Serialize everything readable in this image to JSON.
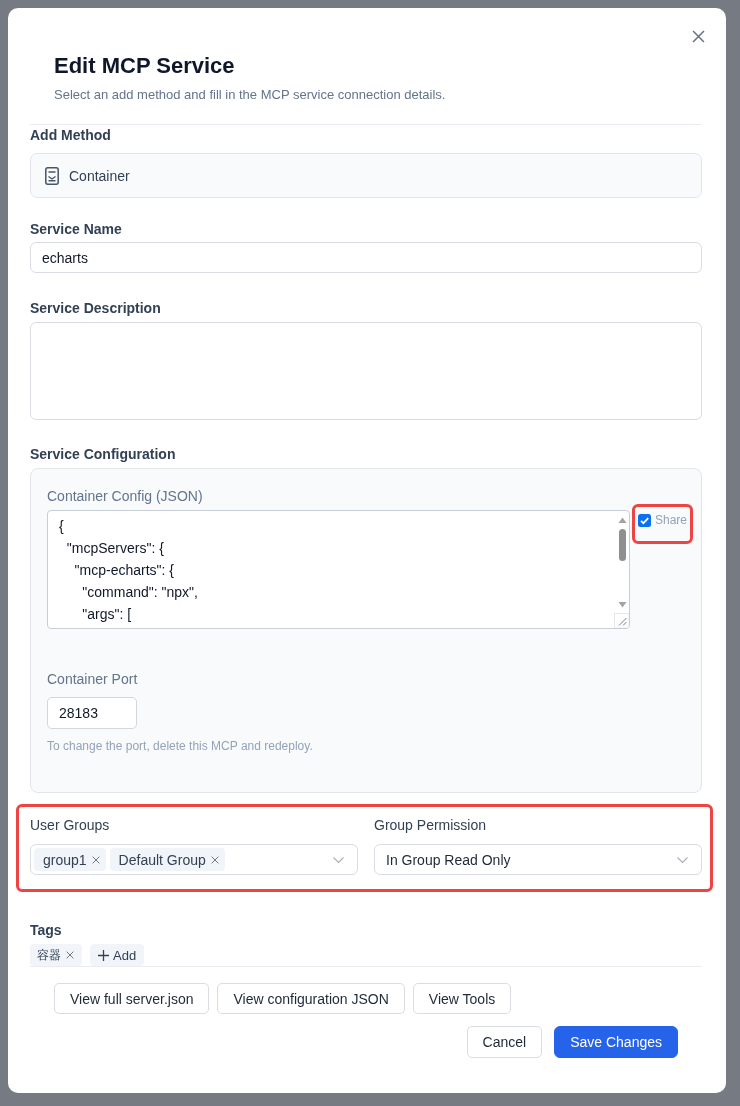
{
  "dialog": {
    "title": "Edit MCP Service",
    "subtitle": "Select an add method and fill in the MCP service connection details."
  },
  "add_method": {
    "label": "Add Method",
    "value": "Container"
  },
  "service_name": {
    "label": "Service Name",
    "value": "echarts"
  },
  "service_description": {
    "label": "Service Description"
  },
  "service_configuration": {
    "label": "Service Configuration",
    "config": {
      "label": "Container Config (JSON)",
      "value": "{\n  \"mcpServers\": {\n    \"mcp-echarts\": {\n      \"command\": \"npx\",\n      \"args\": ["
    },
    "share": {
      "label": "Share",
      "checked": true,
      "highlighted": true
    },
    "port": {
      "label": "Container Port",
      "value": "28183",
      "hint": "To change the port, delete this MCP and redeploy."
    }
  },
  "access": {
    "highlighted": true,
    "user_groups": {
      "label": "User Groups",
      "chips": [
        "group1",
        "Default Group"
      ]
    },
    "group_permission": {
      "label": "Group Permission",
      "value": "In Group Read Only"
    }
  },
  "tags": {
    "label": "Tags",
    "items": [
      "容器"
    ],
    "add_label": "Add"
  },
  "actions": [
    "View full server.json",
    "View configuration JSON",
    "View Tools"
  ],
  "footer": [
    {
      "label": "Cancel",
      "kind": "secondary"
    },
    {
      "label": "Save Changes",
      "kind": "primary"
    }
  ]
}
